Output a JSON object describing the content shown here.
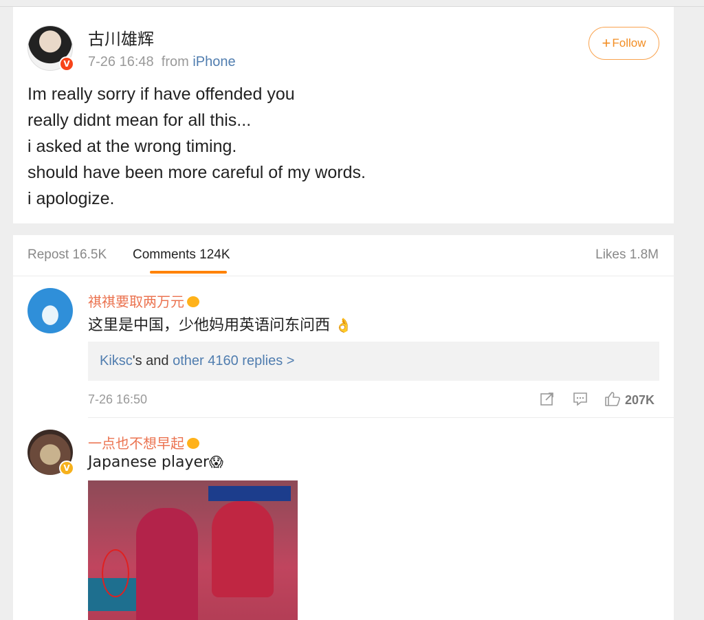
{
  "post": {
    "author": "古川雄辉",
    "time": "7-26 16:48",
    "from_label": "from",
    "source": "iPhone",
    "follow_label": "Follow",
    "text_lines": [
      "Im really sorry if have offended you",
      "really didnt mean for all this...",
      "i asked at the wrong timing.",
      "should have been more careful of my words.",
      "i apologize."
    ]
  },
  "tabs": {
    "repost": "Repost 16.5K",
    "comments": "Comments 124K",
    "likes": "Likes 1.8M"
  },
  "comments": [
    {
      "name": "祺祺要取两万元",
      "text": "这里是中国，少他妈用英语问东问西",
      "emoji": "👌",
      "replies_user": "Kiksc",
      "replies_mid": "'s and ",
      "replies_link": "other 4160 replies >",
      "time": "7-26 16:50",
      "likes": "207K"
    },
    {
      "name": "一点也不想早起",
      "text": "Japanese player",
      "emoji": "😱"
    }
  ],
  "colors": {
    "accent": "#ff8200",
    "name": "#eb7350",
    "link": "#507daf",
    "verified_red": "#f7441a",
    "verified_yellow": "#f6b11c"
  }
}
